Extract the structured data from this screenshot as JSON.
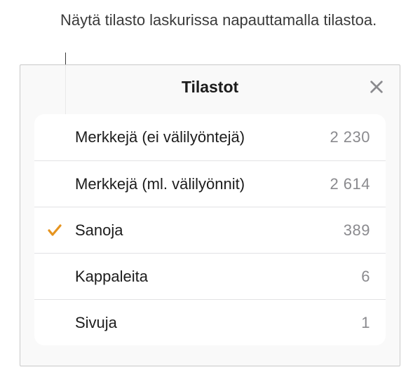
{
  "callout": {
    "text": "Näytä tilasto laskurissa napauttamalla tilastoa."
  },
  "panel": {
    "title": "Tilastot"
  },
  "stats": [
    {
      "label": "Merkkejä (ei välilyöntejä)",
      "value": "2 230",
      "selected": false
    },
    {
      "label": "Merkkejä (ml. välilyönnit)",
      "value": "2 614",
      "selected": false
    },
    {
      "label": "Sanoja",
      "value": "389",
      "selected": true
    },
    {
      "label": "Kappaleita",
      "value": "6",
      "selected": false
    },
    {
      "label": "Sivuja",
      "value": "1",
      "selected": false
    }
  ],
  "colors": {
    "accent": "#e6941f",
    "muted": "#8a8a8e"
  }
}
